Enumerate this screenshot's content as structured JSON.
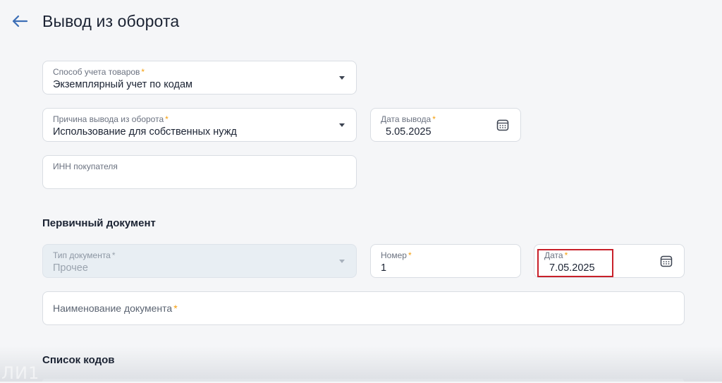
{
  "header": {
    "title": "Вывод из оборота",
    "back_icon": "arrow-left-icon"
  },
  "accounting_method": {
    "label": "Способ учета товаров",
    "required_mark": "*",
    "value": "Экземплярный учет по кодам"
  },
  "withdrawal_reason": {
    "label": "Причина вывода из оборота",
    "required_mark": "*",
    "value": "Использование для собственных нужд"
  },
  "withdrawal_date": {
    "label": "Дата вывода",
    "required_mark": "*",
    "value": "5.05.2025"
  },
  "buyer_inn": {
    "label": "ИНН покупателя",
    "value": ""
  },
  "primary_document": {
    "section_title": "Первичный документ",
    "doc_type": {
      "label": "Тип документа",
      "required_mark": "*",
      "value": "Прочее"
    },
    "number": {
      "label": "Номер",
      "required_mark": "*",
      "value": "1"
    },
    "date": {
      "label": "Дата",
      "required_mark": "*",
      "value": "7.05.2025"
    },
    "doc_name": {
      "label": "Наименование документа",
      "required_mark": "*"
    }
  },
  "codes_list": {
    "section_title": "Список кодов"
  },
  "overlay": {
    "watermark": "ЛИ1",
    "highlight_color": "#c8202a"
  },
  "colors": {
    "accent": "#3d6fb6",
    "required": "#f59e0b",
    "background": "#f5f6f8"
  }
}
